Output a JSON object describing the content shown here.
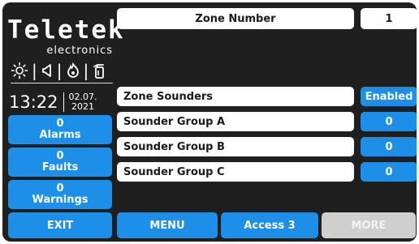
{
  "brand": {
    "logo": "Teletek",
    "subtitle": "electronics"
  },
  "status_icons": [
    "sun-icon",
    "speaker-icon",
    "fire-icon",
    "extinguisher-icon"
  ],
  "clock": {
    "time": "13:22",
    "date_line1": "02.07.",
    "date_line2": "2021"
  },
  "counters": [
    {
      "count": "0",
      "label": "Alarms"
    },
    {
      "count": "0",
      "label": "Faults"
    },
    {
      "count": "0",
      "label": "Warnings"
    }
  ],
  "header": {
    "title": "Zone Number",
    "value": "1"
  },
  "rows": [
    {
      "label": "Zone Sounders",
      "value": "Enabled"
    },
    {
      "label": "Sounder Group A",
      "value": "0"
    },
    {
      "label": "Sounder Group B",
      "value": "0"
    },
    {
      "label": "Sounder Group C",
      "value": "0"
    }
  ],
  "buttons": {
    "exit": "EXIT",
    "menu": "MENU",
    "access": "Access 3",
    "more": "MORE"
  },
  "colors": {
    "accent": "#1e8fe8",
    "background": "#1f1f1f",
    "disabled": "#cfcfcf"
  }
}
